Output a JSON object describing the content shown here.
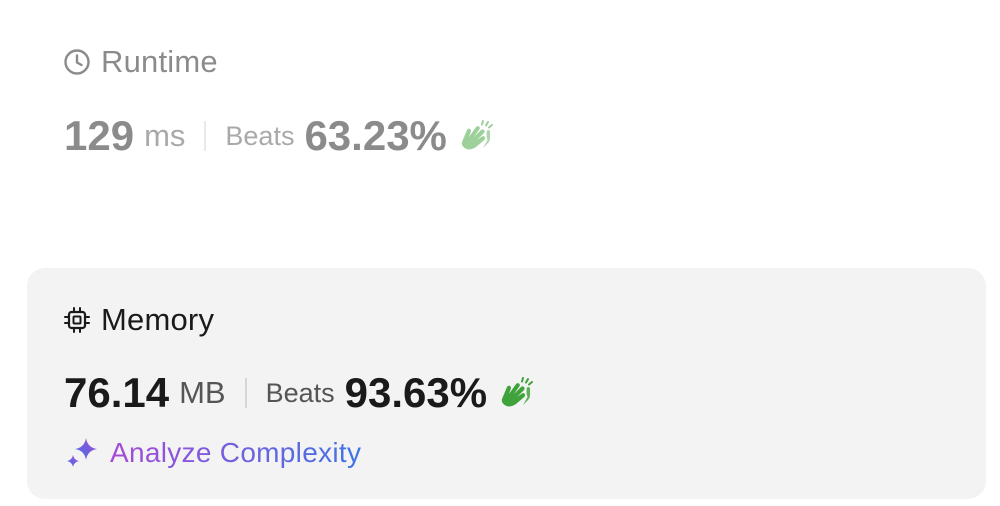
{
  "runtime": {
    "title": "Runtime",
    "value": "129",
    "unit": "ms",
    "beats_label": "Beats",
    "beats_percent": "63.23%",
    "icon": "clock-icon"
  },
  "memory": {
    "title": "Memory",
    "value": "76.14",
    "unit": "MB",
    "beats_label": "Beats",
    "beats_percent": "93.63%",
    "icon": "chip-icon"
  },
  "analyze": {
    "label": "Analyze Complexity",
    "icon": "sparkle-icon"
  },
  "colors": {
    "clap_green": "#3fa23a",
    "gradient_start": "#a64bd6",
    "gradient_end": "#3f74e6",
    "memory_card_bg": "#f3f3f3"
  }
}
